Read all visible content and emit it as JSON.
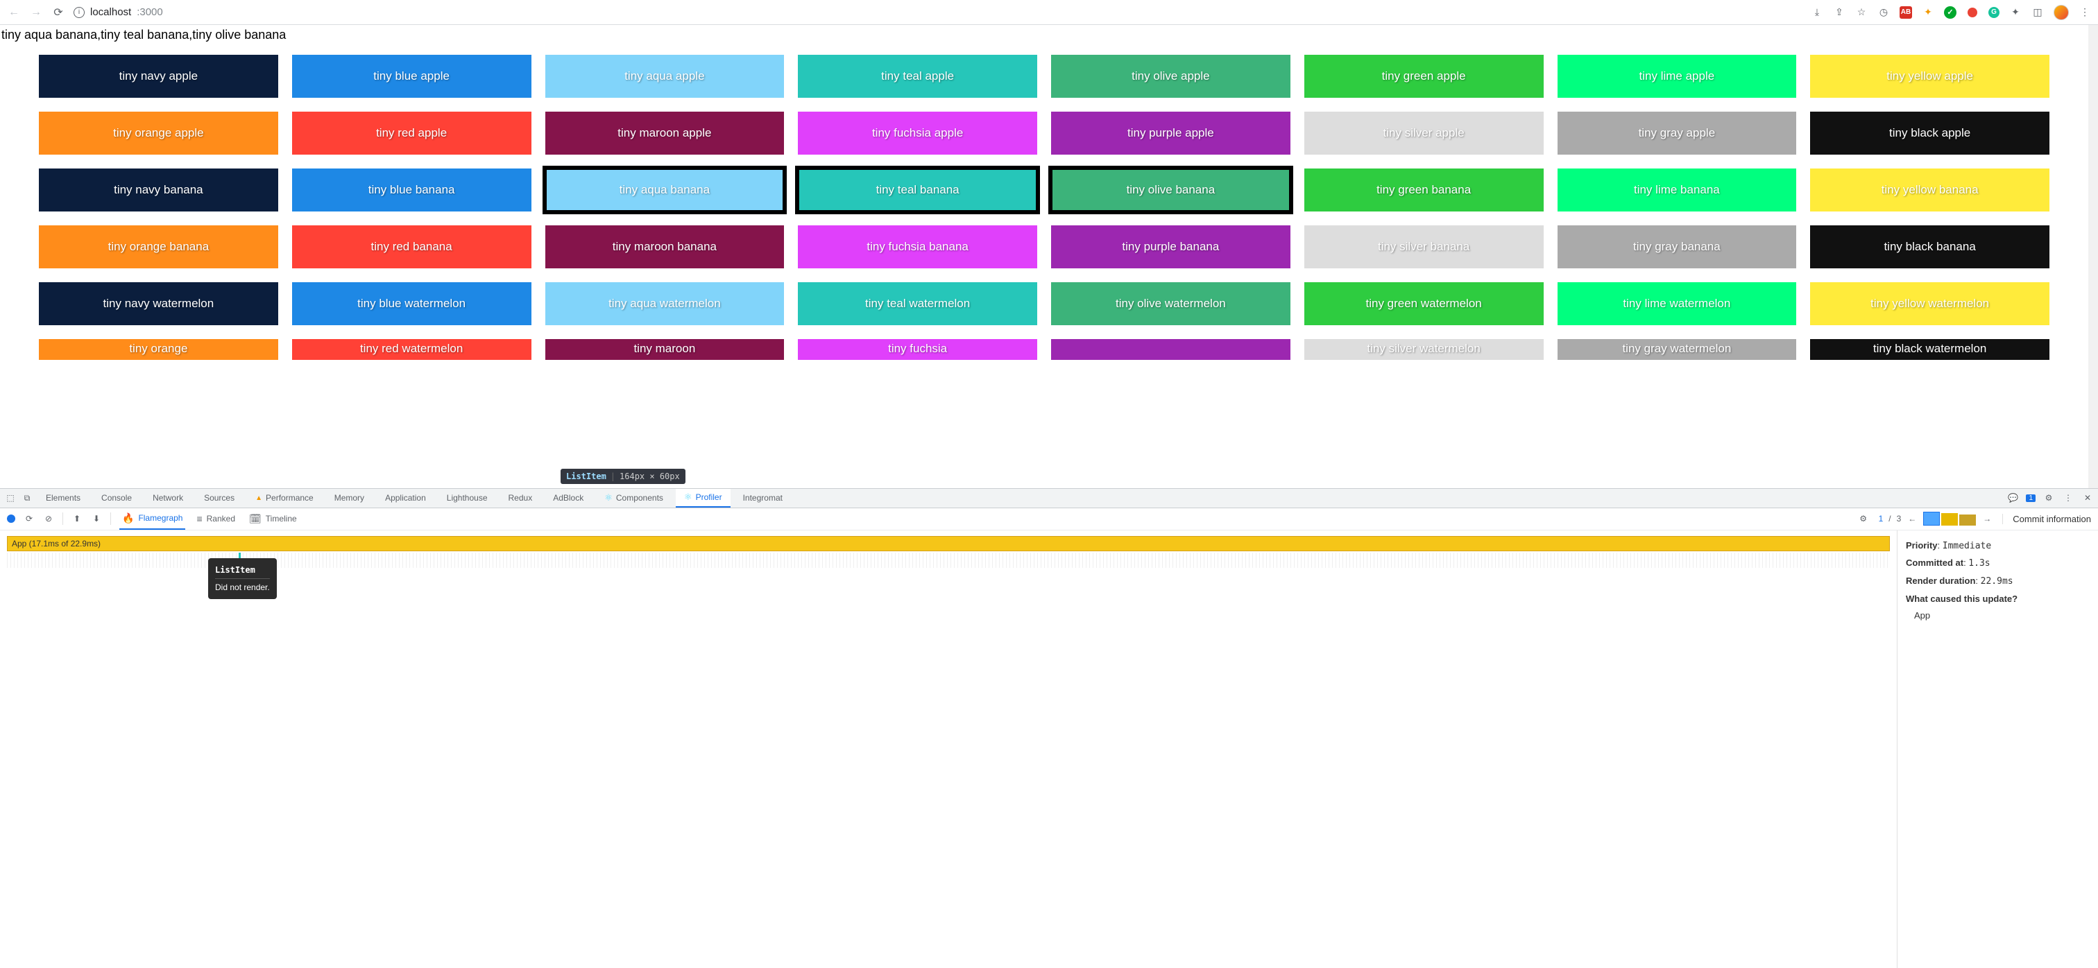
{
  "browser": {
    "url_host": "localhost",
    "url_port": ":3000",
    "extensions": [
      "install",
      "share",
      "star",
      "timer",
      "adblock",
      "postman",
      "evernote",
      "opera",
      "grammarly",
      "puzzle",
      "panel"
    ],
    "menu_dots": "⋮"
  },
  "page": {
    "header_line": "tiny aqua banana,tiny teal banana,tiny olive banana",
    "colors": [
      "navy",
      "blue",
      "aqua",
      "teal",
      "olive",
      "green",
      "lime",
      "yellow",
      "orange",
      "red",
      "maroon",
      "fuchsia",
      "purple",
      "silver",
      "gray",
      "black"
    ],
    "fruits": [
      "apple",
      "banana",
      "watermelon"
    ],
    "size": "tiny",
    "selected": [
      "tiny aqua banana",
      "tiny teal banana",
      "tiny olive banana"
    ],
    "cutoff_labels": [
      "tiny orange",
      "tiny red watermelon",
      "tiny maroon",
      "tiny fuchsia",
      "",
      "tiny silver watermelon",
      "tiny gray watermelon",
      "tiny black watermelon"
    ],
    "inspect_tip": {
      "component": "ListItem",
      "dims": "164px × 60px"
    }
  },
  "devtools": {
    "tabs": [
      "Elements",
      "Console",
      "Network",
      "Sources",
      "Performance",
      "Memory",
      "Application",
      "Lighthouse",
      "Redux",
      "AdBlock",
      "Components",
      "Profiler",
      "Integromat"
    ],
    "active_tab": "Profiler",
    "issues_count": "1",
    "profiler": {
      "view_tabs": {
        "flamegraph": "Flamegraph",
        "ranked": "Ranked",
        "timeline": "Timeline"
      },
      "commit_index": "1",
      "commit_sep": "/",
      "commit_total": "3",
      "commit_info_label": "Commit information",
      "flame_root": "App (17.1ms of 22.9ms)",
      "tooltip_title": "ListItem",
      "tooltip_body": "Did not render.",
      "panel": {
        "priority_k": "Priority",
        "priority_v": "Immediate",
        "committed_k": "Committed at",
        "committed_v": "1.3s",
        "duration_k": "Render duration",
        "duration_v": "22.9ms",
        "cause_k": "What caused this update?",
        "cause_v": "App"
      }
    }
  }
}
